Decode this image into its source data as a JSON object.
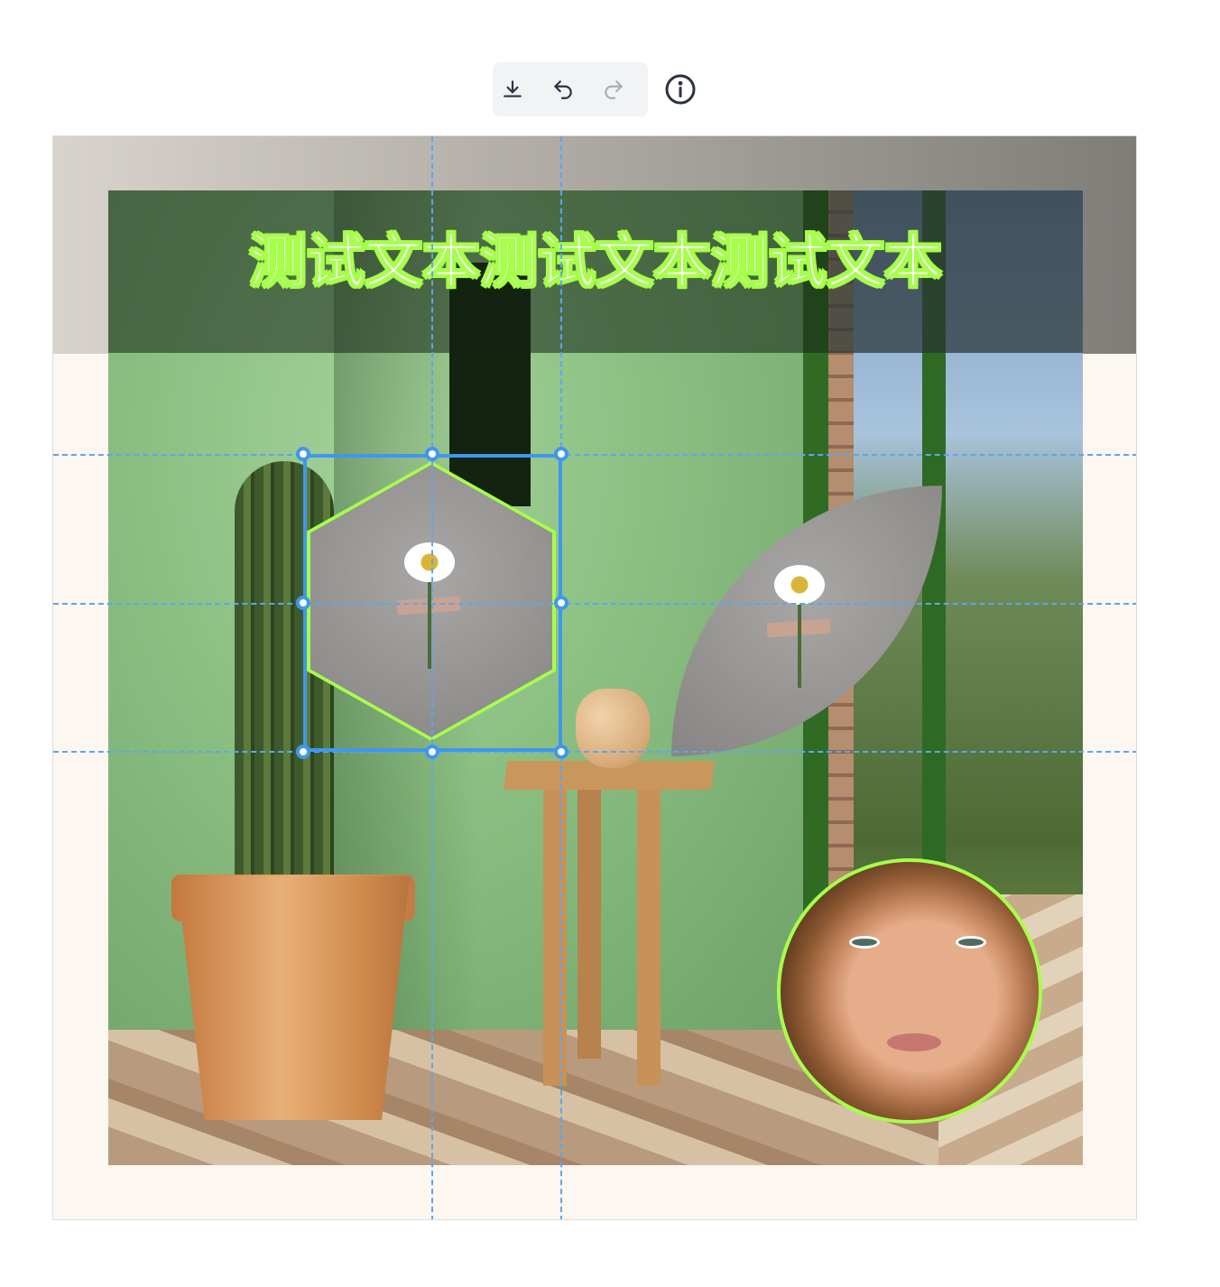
{
  "toolbar": {
    "download_icon": "download-icon",
    "undo_icon": "undo-icon",
    "redo_icon": "redo-icon",
    "info_icon": "info-icon",
    "redo_enabled": false
  },
  "canvas": {
    "headline_text": "测试文本测试文本测试文本",
    "accent_color": "#a6ff4b",
    "selection_color": "#3f97ee",
    "guide_color": "#5aa7ef",
    "background_color": "#fcf7f0"
  },
  "layers": [
    {
      "name": "background-photo",
      "kind": "image"
    },
    {
      "name": "hexagon-daisy-image",
      "kind": "image",
      "shape": "hexagon",
      "selected": true
    },
    {
      "name": "leaf-daisy-image",
      "kind": "image",
      "shape": "leaf"
    },
    {
      "name": "circle-portrait-image",
      "kind": "image",
      "shape": "circle"
    },
    {
      "name": "headline-text",
      "kind": "text"
    }
  ]
}
